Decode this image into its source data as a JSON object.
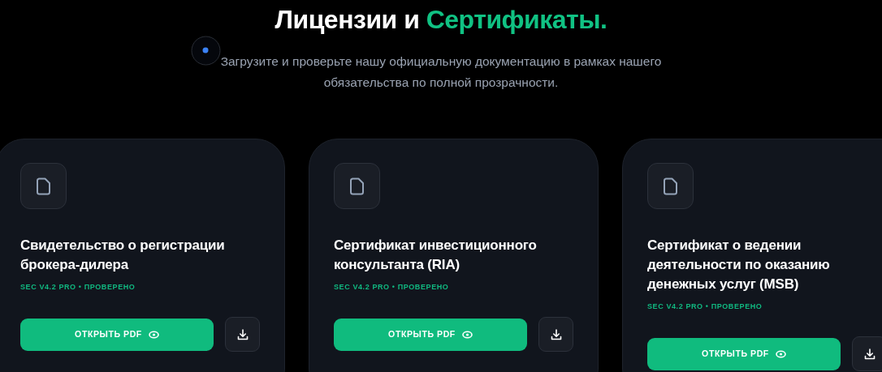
{
  "heading": {
    "text": "Лицензии и",
    "accent": "Сертификаты."
  },
  "subtitle": "Загрузите и проверьте нашу официальную документацию в рамках нашего обязательства по полной прозрачности.",
  "documents": [
    {
      "title": "Свидетельство о регистрации брокера-дилера",
      "meta": "SEC V4.2 PRO • ПРОВЕРЕНО",
      "open_label": "ОТКРЫТЬ PDF"
    },
    {
      "title": "Сертификат инвестиционного консультанта (RIA)",
      "meta": "SEC V4.2 PRO • ПРОВЕРЕНО",
      "open_label": "ОТКРЫТЬ PDF"
    },
    {
      "title": "Сертификат о ведении деятельности по оказанию денежных услуг (MSB)",
      "meta": "SEC V4.2 PRO • ПРОВЕРЕНО",
      "open_label": "ОТКРЫТЬ PDF"
    }
  ]
}
